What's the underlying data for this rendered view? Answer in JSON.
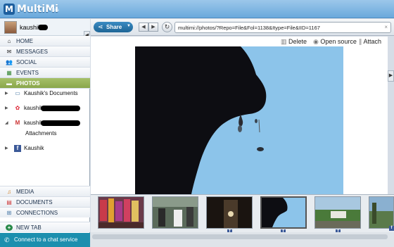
{
  "app": {
    "title": "MultiMi",
    "badge": "beta",
    "logo_letter": "M"
  },
  "user": {
    "name": "kaushik"
  },
  "nav": [
    {
      "label": "HOME",
      "icon": "home-icon",
      "glyph": "⌂"
    },
    {
      "label": "MESSAGES",
      "icon": "envelope-icon",
      "glyph": "✉"
    },
    {
      "label": "SOCIAL",
      "icon": "people-icon",
      "glyph": "👥"
    },
    {
      "label": "EVENTS",
      "icon": "calendar-icon",
      "glyph": "▦"
    },
    {
      "label": "PHOTOS",
      "icon": "folder-icon",
      "glyph": "▬",
      "active": true
    }
  ],
  "tree": [
    {
      "label": "Kaushik's Documents",
      "icon": "computer-icon",
      "glyph": "▭"
    },
    {
      "label": "kaushik",
      "icon": "picasa-icon",
      "glyph": "✿"
    },
    {
      "label": "kaushik",
      "icon": "gmail-icon",
      "glyph": "M",
      "children": [
        "Attachments"
      ]
    },
    {
      "label": "Kaushik",
      "icon": "facebook-icon",
      "glyph": "f"
    }
  ],
  "bottom_nav": [
    {
      "label": "MEDIA",
      "icon": "headphones-icon",
      "glyph": "♫"
    },
    {
      "label": "DOCUMENTS",
      "icon": "document-icon",
      "glyph": "▤"
    },
    {
      "label": "CONNECTIONS",
      "icon": "network-icon",
      "glyph": "⊞"
    },
    {
      "label": "NEW TAB",
      "icon": "plus-icon",
      "glyph": "+"
    }
  ],
  "chat": {
    "label": "Connect to a chat service",
    "icon": "chat-icon",
    "glyph": "✆"
  },
  "toolbar": {
    "share_label": "Share",
    "url": "multimi://photos/?Repo=File&Fol=1138&Itype=File&IID=1167",
    "clear_glyph": "×",
    "back_glyph": "◀",
    "forward_glyph": "▶",
    "refresh_glyph": "↻"
  },
  "actions": [
    {
      "label": "Delete",
      "icon": "trash-icon",
      "glyph": "🗑"
    },
    {
      "label": "Open source",
      "icon": "eye-icon",
      "glyph": "◉"
    },
    {
      "label": "Attach",
      "icon": "paperclip-icon",
      "glyph": "∥"
    }
  ],
  "filmstrip": {
    "thumbnails": [
      {
        "name": "thumb-1",
        "fb": false
      },
      {
        "name": "thumb-2",
        "fb": false
      },
      {
        "name": "thumb-3",
        "fb": true
      },
      {
        "name": "thumb-4",
        "fb": true,
        "selected": true
      },
      {
        "name": "thumb-5",
        "fb": true
      },
      {
        "name": "thumb-6",
        "fb": true
      }
    ]
  },
  "colors": {
    "accent": "#8aa74a",
    "titlebar": "#6aa9dc",
    "chat": "#1c8fae",
    "sky": "#8cc4ea"
  }
}
